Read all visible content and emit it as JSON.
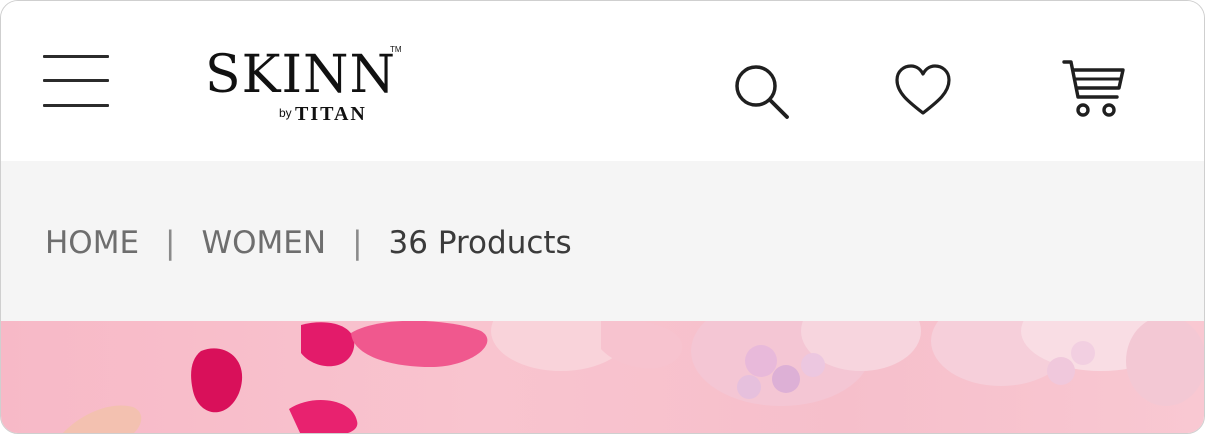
{
  "header": {
    "menu_icon": "hamburger-menu-icon",
    "logo": {
      "main": "SKINN",
      "by": "by",
      "sub": "TITAN",
      "tm": "TM"
    },
    "search_icon": "search-icon",
    "wishlist_icon": "heart-icon",
    "cart_icon": "cart-icon"
  },
  "breadcrumb": {
    "items": [
      "HOME",
      "WOMEN"
    ],
    "separator": "|",
    "count_label": "36 Products"
  },
  "banner": {
    "image": "pink-rose-petals-banner"
  },
  "colors": {
    "header_bg": "#ffffff",
    "breadcrumb_bg": "#f5f5f5",
    "banner_pink": "#f7b9c7",
    "petal_magenta": "#e0195f",
    "icon_dark": "#1f1f1f"
  }
}
